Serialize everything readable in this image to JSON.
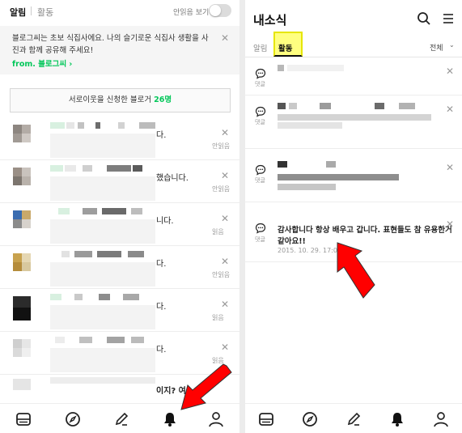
{
  "left": {
    "tabs": {
      "active": "알림",
      "other": "활동"
    },
    "unread_toggle_label": "안읽음 보기",
    "banner": {
      "text": "블로그씨는 초보 식집사에요. 나의 슬기로운 식집사 생활을 사진과 함께 공유해 주세요!",
      "from": "from. 블로그씨 ›"
    },
    "neighbor": {
      "label": "서로이웃을 신청한 블로거",
      "count": "26명"
    },
    "items": [
      {
        "text": "다.",
        "status": "안읽음"
      },
      {
        "text": "했습니다.",
        "status": "안읽음"
      },
      {
        "text": "니다.",
        "status": "읽음"
      },
      {
        "text": "다.",
        "status": "안읽음"
      },
      {
        "text": "다.",
        "status": "읽음"
      },
      {
        "text": "다.",
        "status": "읽음"
      },
      {
        "text": "이지? 여",
        "status": ""
      }
    ],
    "close_symbol": "✕"
  },
  "right": {
    "title": "내소식",
    "tabs": {
      "first": "알림",
      "second": "활동"
    },
    "filter": "전체",
    "icon_label": "댓글",
    "comment": "감사합니다 항상 배우고 갑니다. 표현들도 참 유용한거 같아요!!",
    "date": "2015. 10. 29. 17:05",
    "close_symbol": "✕"
  },
  "colors": {
    "accent_green": "#03c75a",
    "highlight_yellow": "#ffff80",
    "arrow_red": "#ff0000"
  },
  "icons": [
    "search-icon",
    "menu-icon",
    "comment-icon",
    "close-icon",
    "bell-icon",
    "user-icon",
    "compass-icon",
    "pen-icon",
    "feed-icon",
    "toggle-switch",
    "chevron-down-icon"
  ]
}
